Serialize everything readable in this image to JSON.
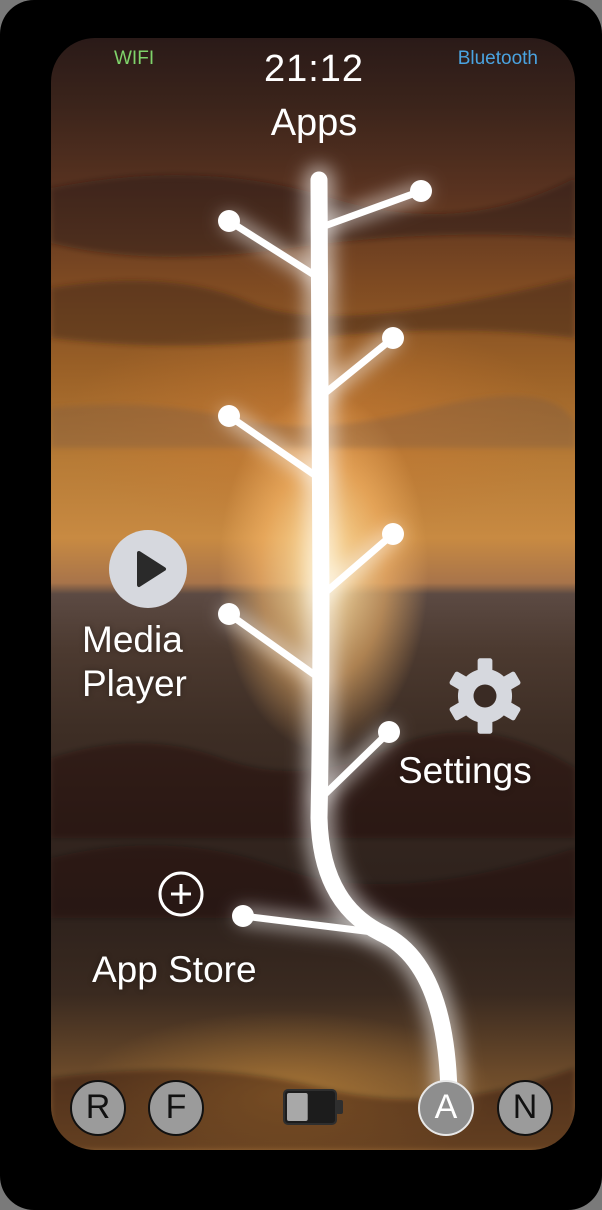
{
  "status_bar": {
    "wifi_label": "WIFI",
    "bluetooth_label": "Bluetooth",
    "time": "21:12",
    "wifi_color": "#7fd36a",
    "bluetooth_color": "#4aa3e0"
  },
  "screen": {
    "title": "Apps"
  },
  "apps": {
    "media_player": {
      "label": "Media\nPlayer",
      "icon": "play-icon"
    },
    "settings": {
      "label": "Settings",
      "icon": "gear-icon"
    },
    "app_store": {
      "label": "App Store",
      "icon": "plus-circle-icon"
    }
  },
  "bottom_bar": {
    "buttons": [
      {
        "label": "R",
        "active": false
      },
      {
        "label": "F",
        "active": false
      },
      {
        "label": "A",
        "active": true
      },
      {
        "label": "N",
        "active": false
      }
    ],
    "battery_icon": "battery-icon",
    "battery_level": 0.45
  }
}
